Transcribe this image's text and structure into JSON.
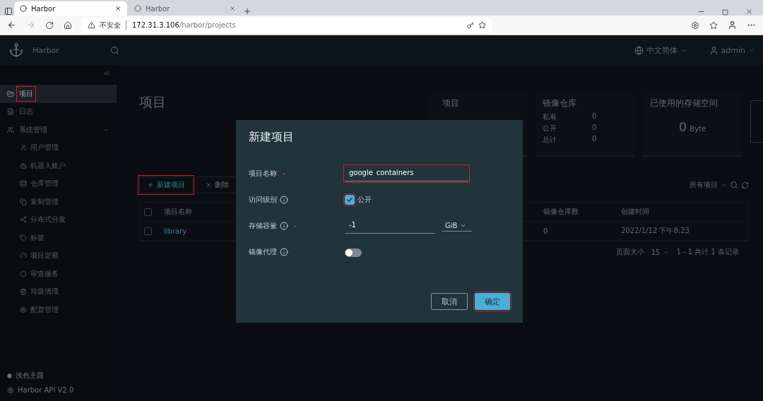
{
  "browser": {
    "tabs": [
      {
        "title": "Harbor",
        "selected": true
      },
      {
        "title": "Harbor",
        "selected": false
      }
    ],
    "security": "不安全",
    "url_host": "172.31.3.106",
    "url_path": "/harbor/projects"
  },
  "header": {
    "brand": "Harbor",
    "language": "中文简体",
    "user": "admin"
  },
  "sidebar": {
    "items": [
      {
        "label": "项目",
        "selected": true,
        "annotated": true
      },
      {
        "label": "日志",
        "selected": false,
        "annotated": false
      },
      {
        "label": "系统管理",
        "selected": false,
        "annotated": false,
        "expanded": true,
        "children": [
          {
            "label": "用户管理"
          },
          {
            "label": "机器人账户"
          },
          {
            "label": "仓库管理"
          },
          {
            "label": "复制管理"
          },
          {
            "label": "分布式分发"
          },
          {
            "label": "标签"
          },
          {
            "label": "项目定额"
          },
          {
            "label": "审查服务"
          },
          {
            "label": "垃圾清理"
          },
          {
            "label": "配置管理"
          }
        ]
      }
    ],
    "footer": [
      "浅色主题",
      "Harbor API V2.0"
    ]
  },
  "page": {
    "title": "项目",
    "stats": {
      "projects_title": "项目",
      "repos_title": "镜像仓库",
      "repo_rows": [
        {
          "label": "私有",
          "value": "0"
        },
        {
          "label": "公开",
          "value": "0"
        },
        {
          "label": "总计",
          "value": "0"
        }
      ],
      "storage_title": "已使用的存储空间",
      "storage_value": "0",
      "storage_unit": "Byte"
    },
    "toolbar": {
      "new_button": "新建项目",
      "new_annotated": true,
      "delete_button": "删除",
      "filter": "所有项目"
    },
    "table": {
      "columns": [
        "项目名称",
        "镜像仓库数",
        "创建时间"
      ],
      "all_checked": false,
      "rows": [
        {
          "checked": false,
          "name": "library",
          "repos": "0",
          "created": "2022/1/12 下午8:23"
        }
      ]
    },
    "pagination": {
      "page_size_label": "页面大小",
      "page_size": "15",
      "summary": "1 - 1 共计 1 条记录"
    }
  },
  "dialog": {
    "title": "新建项目",
    "fields": [
      {
        "kind": "text",
        "label": "项目名称",
        "required": true,
        "info": false,
        "value": "google_containers",
        "annotated": true
      },
      {
        "kind": "checkbox",
        "label": "访问级别",
        "required": false,
        "info": true,
        "checked": true,
        "option": "公开",
        "annotated": true
      },
      {
        "kind": "quota",
        "label": "存储容量",
        "required": true,
        "info": true,
        "value": "-1",
        "unit": "GiB"
      },
      {
        "kind": "switch",
        "label": "镜像代理",
        "required": false,
        "info": true,
        "on": false
      }
    ],
    "buttons": [
      {
        "label": "取消",
        "primary": false,
        "annotated": false
      },
      {
        "label": "确定",
        "primary": true,
        "annotated": true
      }
    ]
  }
}
